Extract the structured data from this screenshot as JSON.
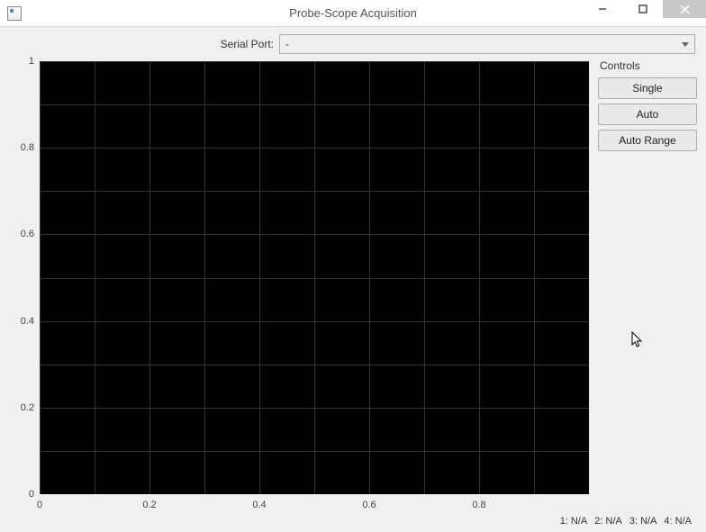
{
  "window": {
    "title": "Probe-Scope Acquisition"
  },
  "port": {
    "label": "Serial Port:",
    "value": "-"
  },
  "controls": {
    "title": "Controls",
    "single": "Single",
    "auto": "Auto",
    "autorange": "Auto Range"
  },
  "status": {
    "ch1": "1: N/A",
    "ch2": "2: N/A",
    "ch3": "3: N/A",
    "ch4": "4: N/A"
  },
  "chart_data": {
    "type": "line",
    "series": [],
    "title": "",
    "xlabel": "",
    "ylabel": "",
    "xlim": [
      0,
      1
    ],
    "ylim": [
      0,
      1
    ],
    "xticks": [
      0,
      0.2,
      0.4,
      0.6,
      0.8
    ],
    "yticks": [
      0,
      0.2,
      0.4,
      0.6,
      0.8,
      1
    ],
    "grid": true,
    "bg": "#000000",
    "grid_color": "#323232"
  }
}
